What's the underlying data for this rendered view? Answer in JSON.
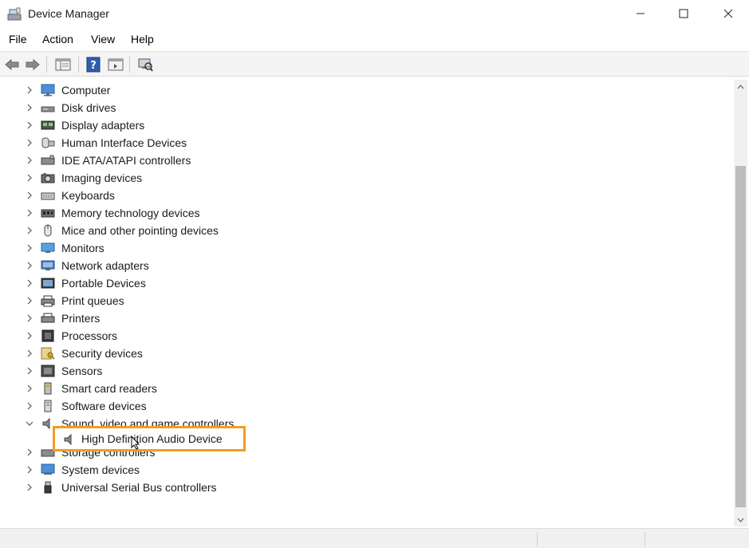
{
  "window": {
    "title": "Device Manager"
  },
  "menu": [
    "File",
    "Action",
    "View",
    "Help"
  ],
  "toolbar": {
    "buttons": [
      "back-icon",
      "forward-icon",
      "properties-pane-icon",
      "help-icon",
      "console-tree-icon",
      "scan-hardware-icon"
    ]
  },
  "tree": {
    "items": [
      {
        "label": "Computer",
        "icon": "computer-icon",
        "state": "collapsed"
      },
      {
        "label": "Disk drives",
        "icon": "disk-drive-icon",
        "state": "collapsed"
      },
      {
        "label": "Display adapters",
        "icon": "display-adapter-icon",
        "state": "collapsed"
      },
      {
        "label": "Human Interface Devices",
        "icon": "hid-icon",
        "state": "collapsed"
      },
      {
        "label": "IDE ATA/ATAPI controllers",
        "icon": "ide-controller-icon",
        "state": "collapsed"
      },
      {
        "label": "Imaging devices",
        "icon": "camera-icon",
        "state": "collapsed"
      },
      {
        "label": "Keyboards",
        "icon": "keyboard-icon",
        "state": "collapsed"
      },
      {
        "label": "Memory technology devices",
        "icon": "memory-icon",
        "state": "collapsed"
      },
      {
        "label": "Mice and other pointing devices",
        "icon": "mouse-icon",
        "state": "collapsed"
      },
      {
        "label": "Monitors",
        "icon": "monitor-icon",
        "state": "collapsed"
      },
      {
        "label": "Network adapters",
        "icon": "network-icon",
        "state": "collapsed"
      },
      {
        "label": "Portable Devices",
        "icon": "portable-device-icon",
        "state": "collapsed"
      },
      {
        "label": "Print queues",
        "icon": "print-queue-icon",
        "state": "collapsed"
      },
      {
        "label": "Printers",
        "icon": "printer-icon",
        "state": "collapsed"
      },
      {
        "label": "Processors",
        "icon": "processor-icon",
        "state": "collapsed"
      },
      {
        "label": "Security devices",
        "icon": "security-key-icon",
        "state": "collapsed"
      },
      {
        "label": "Sensors",
        "icon": "sensor-icon",
        "state": "collapsed"
      },
      {
        "label": "Smart card readers",
        "icon": "smart-card-icon",
        "state": "collapsed"
      },
      {
        "label": "Software devices",
        "icon": "software-device-icon",
        "state": "collapsed"
      },
      {
        "label": "Sound, video and game controllers",
        "icon": "speaker-icon",
        "state": "expanded"
      },
      {
        "label": "Storage controllers",
        "icon": "storage-icon",
        "state": "collapsed"
      },
      {
        "label": "System devices",
        "icon": "system-device-icon",
        "state": "collapsed"
      },
      {
        "label": "Universal Serial Bus controllers",
        "icon": "usb-icon",
        "state": "collapsed"
      }
    ],
    "expanded_child": {
      "label": "High Definition Audio Device",
      "icon": "speaker-icon",
      "highlight_color": "#f39c1f"
    }
  }
}
